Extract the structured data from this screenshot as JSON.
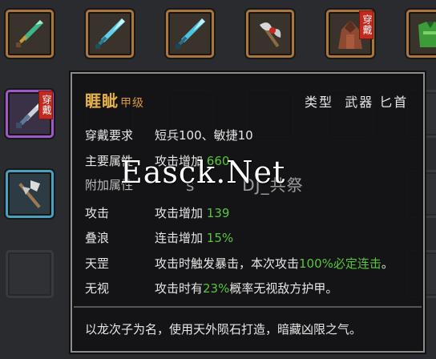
{
  "slot_tag": "穿戴",
  "item": {
    "name": "睚眦",
    "grade": "甲级",
    "type_label": "类型",
    "type_value": "武器 匕首",
    "requirement_label": "穿戴要求",
    "requirement_value": "短兵100、敏捷10",
    "main_attr_label": "主要属性",
    "main_attr_text": "攻击增加",
    "main_attr_num": "660",
    "extra_attr_label": "附加属性",
    "stats": [
      {
        "label": "攻击",
        "text": "攻击增加",
        "num": "139"
      },
      {
        "label": "叠浪",
        "text": "连击增加",
        "num": "15%"
      }
    ],
    "skill1_label": "天罡",
    "skill1_pre": "攻击时触发暴击，本次攻击",
    "skill1_green": "100%必定连击",
    "skill1_post": "。",
    "skill2_label": "无视",
    "skill2_pre": "攻击时有",
    "skill2_green": "23%",
    "skill2_post": "概率无视敌方护甲。",
    "description": "以龙次子为名，使用天外陨石打造，暗藏凶限之气。"
  },
  "watermark": {
    "main": "Easck.Net",
    "sub": "DJ_共祭",
    "fragment": "s"
  },
  "colors": {
    "name": "#e6b04a",
    "highlight": "#58c53c",
    "orange_border": "#a9773d",
    "purple_border": "#9b5ac8",
    "blue_border": "#4aa0c0",
    "tag_red": "#c32a1f"
  },
  "icons": [
    "jade-dagger-icon",
    "cyan-sword-icon",
    "cyan-sword-icon",
    "axe-icon",
    "hooded-robe-icon",
    "green-armor-icon",
    "silver-dagger-icon",
    "halberd-icon"
  ]
}
